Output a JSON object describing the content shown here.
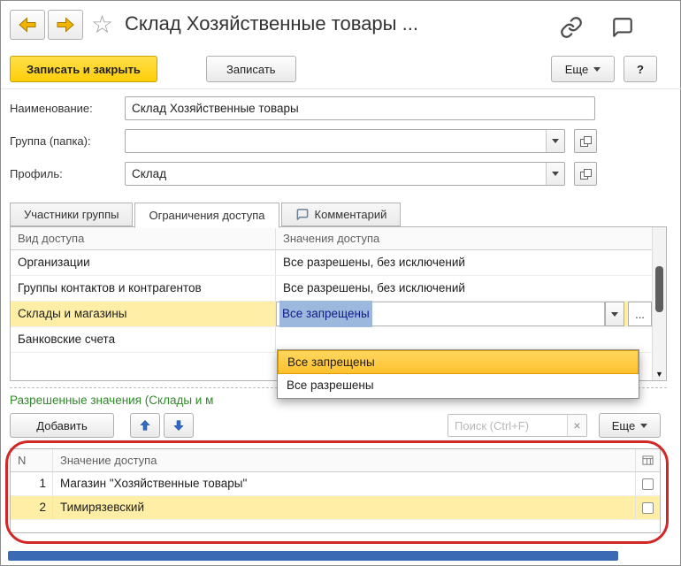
{
  "window": {
    "title": "Склад Хозяйственные товары ..."
  },
  "toolbar": {
    "save_close": "Записать и закрыть",
    "save": "Записать",
    "more": "Еще",
    "help": "?"
  },
  "fields": {
    "name_label": "Наименование:",
    "name_value": "Склад Хозяйственные товары",
    "group_label": "Группа (папка):",
    "group_value": "",
    "profile_label": "Профиль:",
    "profile_value": "Склад"
  },
  "tabs": {
    "members": "Участники группы",
    "restrictions": "Ограничения доступа",
    "comment": "Комментарий"
  },
  "access": {
    "col_kind": "Вид доступа",
    "col_value": "Значения доступа",
    "rows": [
      {
        "kind": "Организации",
        "value": "Все разрешены, без исключений"
      },
      {
        "kind": "Группы контактов и контрагентов",
        "value": "Все разрешены, без исключений"
      },
      {
        "kind": "Склады и магазины",
        "value": "Все запрещены"
      },
      {
        "kind": "Банковские счета",
        "value": ""
      }
    ],
    "choose_button": "...",
    "scroll_down": "▼"
  },
  "dropdown": {
    "options": [
      "Все запрещены",
      "Все разрешены"
    ]
  },
  "allowed": {
    "title": "Разрешенные значения (Склады и м",
    "add": "Добавить",
    "search_placeholder": "Поиск (Ctrl+F)",
    "clear": "×",
    "more": "Еще"
  },
  "values": {
    "col_n": "N",
    "col_value": "Значение доступа",
    "rows": [
      {
        "n": "1",
        "value": "Магазин \"Хозяйственные товары\""
      },
      {
        "n": "2",
        "value": "Тимирязевский"
      }
    ]
  },
  "colors": {
    "accent_yellow": "#ffd60a",
    "row_highlight": "#ffefa6",
    "option_highlight": "#ffc12e",
    "annotation_red": "#d22727",
    "scrollbar_blue": "#3a6ab3",
    "section_green": "#2f8a27"
  }
}
